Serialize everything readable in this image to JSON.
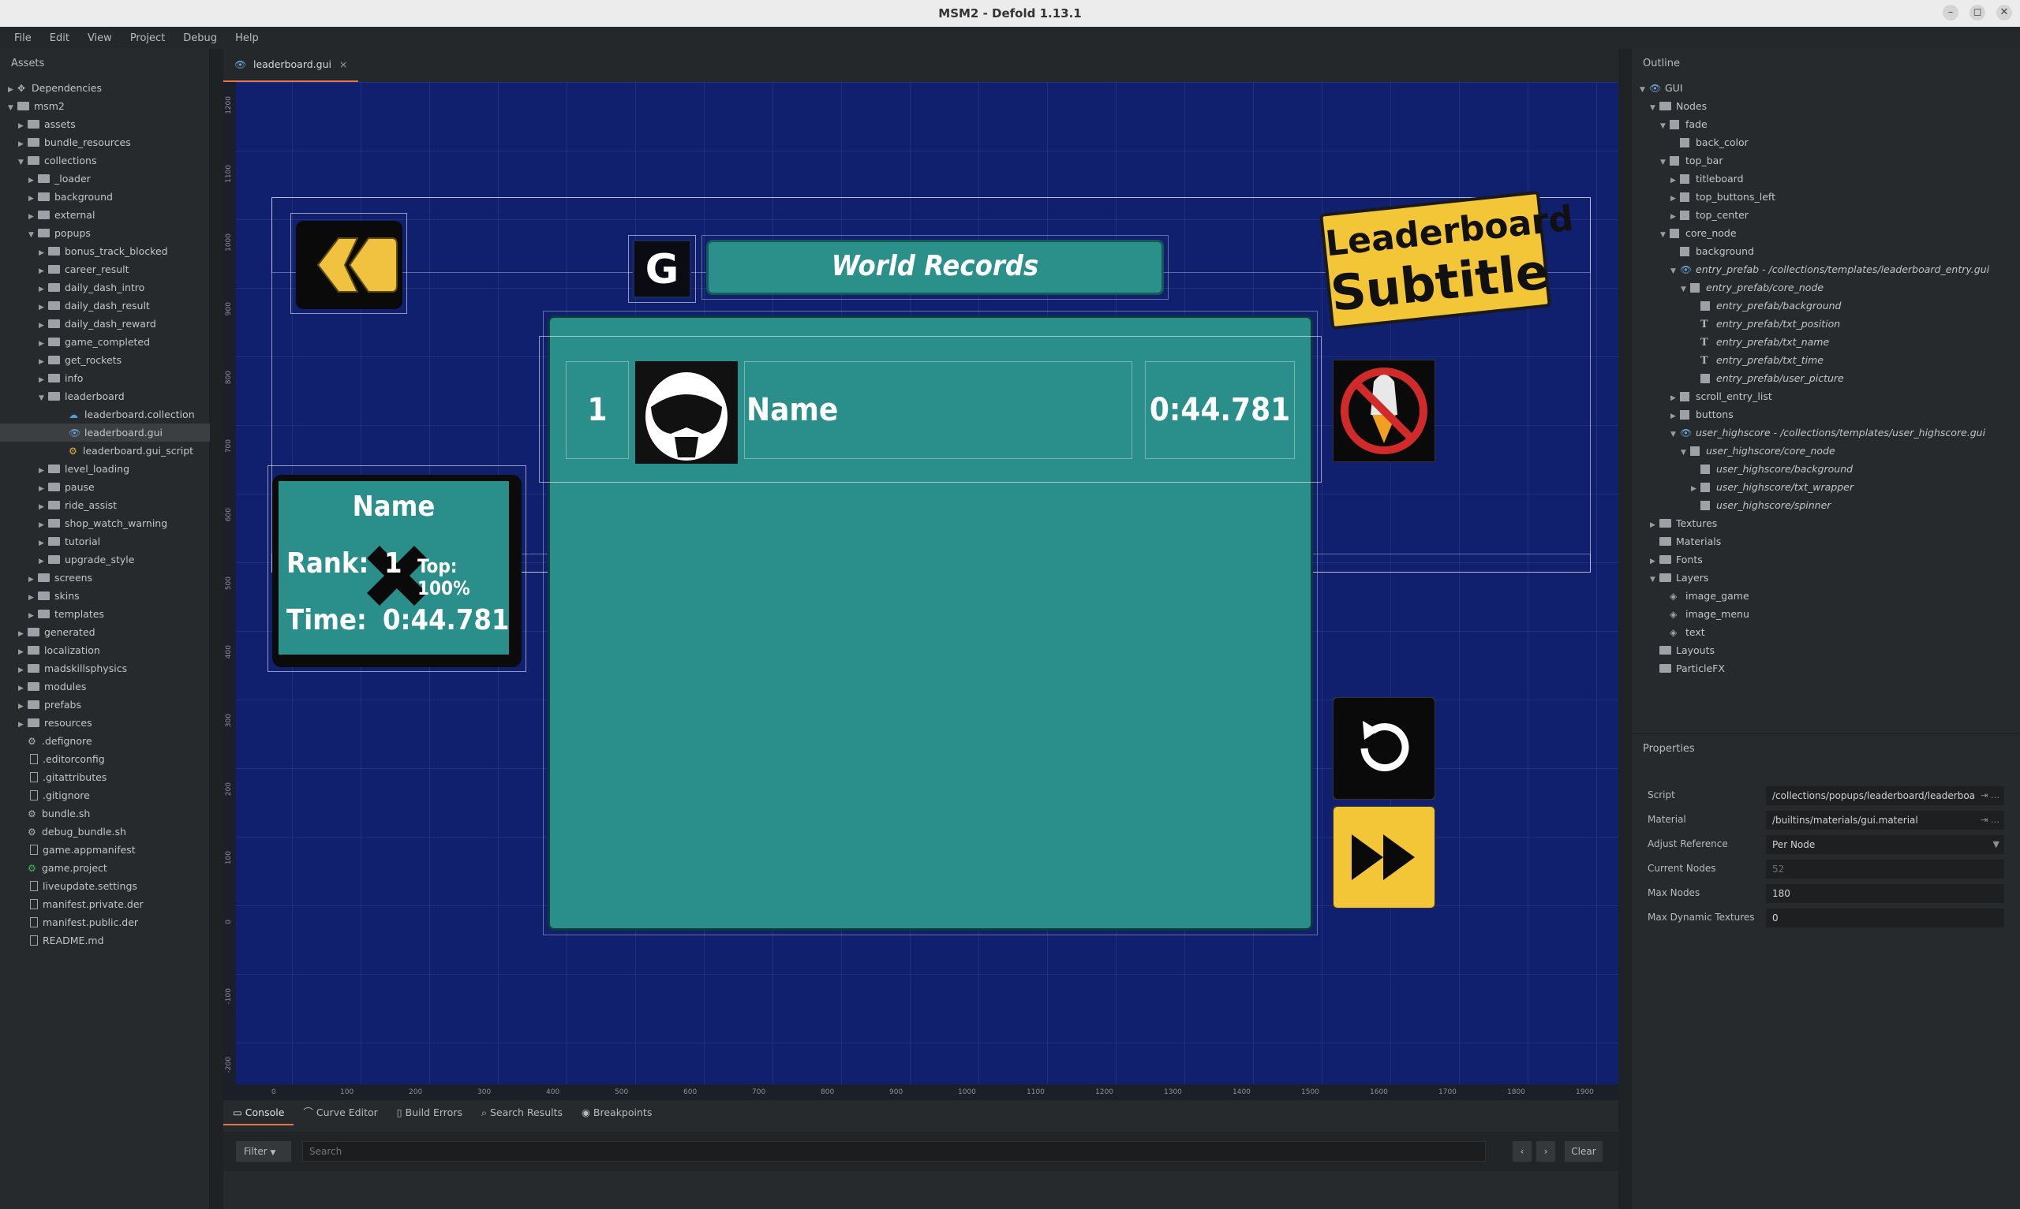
{
  "window": {
    "title": "MSM2 - Defold 1.13.1",
    "min": "–",
    "max": "◻",
    "close": "✕"
  },
  "menu": [
    "File",
    "Edit",
    "View",
    "Project",
    "Debug",
    "Help"
  ],
  "assets": {
    "title": "Assets",
    "items": [
      {
        "label": "Dependencies",
        "depth": 0,
        "arrow": "▶",
        "icon": "puzzle"
      },
      {
        "label": "msm2",
        "depth": 0,
        "arrow": "▼",
        "icon": "folder"
      },
      {
        "label": "assets",
        "depth": 1,
        "arrow": "▶",
        "icon": "folder"
      },
      {
        "label": "bundle_resources",
        "depth": 1,
        "arrow": "▶",
        "icon": "folder"
      },
      {
        "label": "collections",
        "depth": 1,
        "arrow": "▼",
        "icon": "folder"
      },
      {
        "label": "_loader",
        "depth": 2,
        "arrow": "▶",
        "icon": "folder"
      },
      {
        "label": "background",
        "depth": 2,
        "arrow": "▶",
        "icon": "folder"
      },
      {
        "label": "external",
        "depth": 2,
        "arrow": "▶",
        "icon": "folder"
      },
      {
        "label": "popups",
        "depth": 2,
        "arrow": "▼",
        "icon": "folder"
      },
      {
        "label": "bonus_track_blocked",
        "depth": 3,
        "arrow": "▶",
        "icon": "folder"
      },
      {
        "label": "career_result",
        "depth": 3,
        "arrow": "▶",
        "icon": "folder"
      },
      {
        "label": "daily_dash_intro",
        "depth": 3,
        "arrow": "▶",
        "icon": "folder"
      },
      {
        "label": "daily_dash_result",
        "depth": 3,
        "arrow": "▶",
        "icon": "folder"
      },
      {
        "label": "daily_dash_reward",
        "depth": 3,
        "arrow": "▶",
        "icon": "folder"
      },
      {
        "label": "game_completed",
        "depth": 3,
        "arrow": "▶",
        "icon": "folder"
      },
      {
        "label": "get_rockets",
        "depth": 3,
        "arrow": "▶",
        "icon": "folder"
      },
      {
        "label": "info",
        "depth": 3,
        "arrow": "▶",
        "icon": "folder"
      },
      {
        "label": "leaderboard",
        "depth": 3,
        "arrow": "▼",
        "icon": "folder"
      },
      {
        "label": "leaderboard.collection",
        "depth": 5,
        "arrow": "",
        "icon": "collection"
      },
      {
        "label": "leaderboard.gui",
        "depth": 5,
        "arrow": "",
        "icon": "eye",
        "selected": true
      },
      {
        "label": "leaderboard.gui_script",
        "depth": 5,
        "arrow": "",
        "icon": "gear-yellow"
      },
      {
        "label": "level_loading",
        "depth": 3,
        "arrow": "▶",
        "icon": "folder"
      },
      {
        "label": "pause",
        "depth": 3,
        "arrow": "▶",
        "icon": "folder"
      },
      {
        "label": "ride_assist",
        "depth": 3,
        "arrow": "▶",
        "icon": "folder"
      },
      {
        "label": "shop_watch_warning",
        "depth": 3,
        "arrow": "▶",
        "icon": "folder"
      },
      {
        "label": "tutorial",
        "depth": 3,
        "arrow": "▶",
        "icon": "folder"
      },
      {
        "label": "upgrade_style",
        "depth": 3,
        "arrow": "▶",
        "icon": "folder"
      },
      {
        "label": "screens",
        "depth": 2,
        "arrow": "▶",
        "icon": "folder"
      },
      {
        "label": "skins",
        "depth": 2,
        "arrow": "▶",
        "icon": "folder"
      },
      {
        "label": "templates",
        "depth": 2,
        "arrow": "▶",
        "icon": "folder"
      },
      {
        "label": "generated",
        "depth": 1,
        "arrow": "▶",
        "icon": "folder"
      },
      {
        "label": "localization",
        "depth": 1,
        "arrow": "▶",
        "icon": "folder"
      },
      {
        "label": "madskillsphysics",
        "depth": 1,
        "arrow": "▶",
        "icon": "folder"
      },
      {
        "label": "modules",
        "depth": 1,
        "arrow": "▶",
        "icon": "folder"
      },
      {
        "label": "prefabs",
        "depth": 1,
        "arrow": "▶",
        "icon": "folder"
      },
      {
        "label": "resources",
        "depth": 1,
        "arrow": "▶",
        "icon": "folder"
      },
      {
        "label": ".defignore",
        "depth": 1,
        "arrow": "",
        "icon": "gear"
      },
      {
        "label": ".editorconfig",
        "depth": 1,
        "arrow": "",
        "icon": "file"
      },
      {
        "label": ".gitattributes",
        "depth": 1,
        "arrow": "",
        "icon": "file"
      },
      {
        "label": ".gitignore",
        "depth": 1,
        "arrow": "",
        "icon": "file"
      },
      {
        "label": "bundle.sh",
        "depth": 1,
        "arrow": "",
        "icon": "gear"
      },
      {
        "label": "debug_bundle.sh",
        "depth": 1,
        "arrow": "",
        "icon": "gear"
      },
      {
        "label": "game.appmanifest",
        "depth": 1,
        "arrow": "",
        "icon": "file"
      },
      {
        "label": "game.project",
        "depth": 1,
        "arrow": "",
        "icon": "gear-green"
      },
      {
        "label": "liveupdate.settings",
        "depth": 1,
        "arrow": "",
        "icon": "file"
      },
      {
        "label": "manifest.private.der",
        "depth": 1,
        "arrow": "",
        "icon": "file"
      },
      {
        "label": "manifest.public.der",
        "depth": 1,
        "arrow": "",
        "icon": "file"
      },
      {
        "label": "README.md",
        "depth": 1,
        "arrow": "",
        "icon": "file"
      }
    ]
  },
  "editor_tab": {
    "label": "leaderboard.gui",
    "close": "×"
  },
  "gui": {
    "world_records": "World Records",
    "subtitle_line1": "Leaderboard",
    "subtitle_line2": "Subtitle",
    "entry_position": "1",
    "entry_name": "Name",
    "entry_time": "0:44.781",
    "user_name": "Name",
    "user_rank_label": "Rank:",
    "user_rank_value": "1",
    "user_top": "Top: 100%",
    "user_time_label": "Time:",
    "user_time_value": "0:44.781",
    "refresh_letter": "G"
  },
  "ruler": {
    "x": [
      "0",
      "100",
      "200",
      "300",
      "400",
      "500",
      "600",
      "700",
      "800",
      "900",
      "1000",
      "1100",
      "1200",
      "1300",
      "1400",
      "1500",
      "1600",
      "1700",
      "1800",
      "1900"
    ],
    "y": [
      "1200",
      "1100",
      "1000",
      "900",
      "800",
      "700",
      "600",
      "500",
      "400",
      "300",
      "200",
      "100",
      "0",
      "-100",
      "-200"
    ]
  },
  "bottom_tabs": [
    "Console",
    "Curve Editor",
    "Build Errors",
    "Search Results",
    "Breakpoints"
  ],
  "console": {
    "filter": "Filter",
    "search_placeholder": "Search",
    "prev": "‹",
    "next": "›",
    "clear": "Clear"
  },
  "outline": {
    "title": "Outline",
    "items": [
      {
        "label": "GUI",
        "depth": 0,
        "arrow": "▼",
        "icon": "eye"
      },
      {
        "label": "Nodes",
        "depth": 1,
        "arrow": "▼",
        "icon": "folder"
      },
      {
        "label": "fade",
        "depth": 2,
        "arrow": "▼",
        "icon": "node"
      },
      {
        "label": "back_color",
        "depth": 3,
        "arrow": "",
        "icon": "node"
      },
      {
        "label": "top_bar",
        "depth": 2,
        "arrow": "▼",
        "icon": "node"
      },
      {
        "label": "titleboard",
        "depth": 3,
        "arrow": "▶",
        "icon": "node"
      },
      {
        "label": "top_buttons_left",
        "depth": 3,
        "arrow": "▶",
        "icon": "node"
      },
      {
        "label": "top_center",
        "depth": 3,
        "arrow": "▶",
        "icon": "node"
      },
      {
        "label": "core_node",
        "depth": 2,
        "arrow": "▼",
        "icon": "node"
      },
      {
        "label": "background",
        "depth": 3,
        "arrow": "",
        "icon": "node"
      },
      {
        "label": "entry_prefab - /collections/templates/leaderboard_entry.gui",
        "depth": 3,
        "arrow": "▼",
        "icon": "eye",
        "italic": true
      },
      {
        "label": "entry_prefab/core_node",
        "depth": 4,
        "arrow": "▼",
        "icon": "node",
        "italic": true
      },
      {
        "label": "entry_prefab/background",
        "depth": 5,
        "arrow": "",
        "icon": "node",
        "italic": true
      },
      {
        "label": "entry_prefab/txt_position",
        "depth": 5,
        "arrow": "",
        "icon": "text",
        "italic": true
      },
      {
        "label": "entry_prefab/txt_name",
        "depth": 5,
        "arrow": "",
        "icon": "text",
        "italic": true
      },
      {
        "label": "entry_prefab/txt_time",
        "depth": 5,
        "arrow": "",
        "icon": "text",
        "italic": true
      },
      {
        "label": "entry_prefab/user_picture",
        "depth": 5,
        "arrow": "",
        "icon": "node",
        "italic": true
      },
      {
        "label": "scroll_entry_list",
        "depth": 3,
        "arrow": "▶",
        "icon": "node"
      },
      {
        "label": "buttons",
        "depth": 3,
        "arrow": "▶",
        "icon": "node"
      },
      {
        "label": "user_highscore - /collections/templates/user_highscore.gui",
        "depth": 3,
        "arrow": "▼",
        "icon": "eye",
        "italic": true
      },
      {
        "label": "user_highscore/core_node",
        "depth": 4,
        "arrow": "▼",
        "icon": "node",
        "italic": true
      },
      {
        "label": "user_highscore/background",
        "depth": 5,
        "arrow": "",
        "icon": "node",
        "italic": true
      },
      {
        "label": "user_highscore/txt_wrapper",
        "depth": 5,
        "arrow": "▶",
        "icon": "node",
        "italic": true
      },
      {
        "label": "user_highscore/spinner",
        "depth": 5,
        "arrow": "",
        "icon": "node",
        "italic": true
      },
      {
        "label": "Textures",
        "depth": 1,
        "arrow": "▶",
        "icon": "folder"
      },
      {
        "label": "Materials",
        "depth": 1,
        "arrow": "",
        "icon": "folder"
      },
      {
        "label": "Fonts",
        "depth": 1,
        "arrow": "▶",
        "icon": "folder"
      },
      {
        "label": "Layers",
        "depth": 1,
        "arrow": "▼",
        "icon": "folder"
      },
      {
        "label": "image_game",
        "depth": 2,
        "arrow": "",
        "icon": "layer"
      },
      {
        "label": "image_menu",
        "depth": 2,
        "arrow": "",
        "icon": "layer"
      },
      {
        "label": "text",
        "depth": 2,
        "arrow": "",
        "icon": "layer"
      },
      {
        "label": "Layouts",
        "depth": 1,
        "arrow": "",
        "icon": "folder"
      },
      {
        "label": "ParticleFX",
        "depth": 1,
        "arrow": "",
        "icon": "folder"
      }
    ]
  },
  "properties": {
    "title": "Properties",
    "rows": [
      {
        "label": "Script",
        "value": "/collections/popups/leaderboard/leaderboa",
        "icons": "⇥  …"
      },
      {
        "label": "Material",
        "value": "/builtins/materials/gui.material",
        "icons": "⇥  …"
      },
      {
        "label": "Adjust Reference",
        "value": "Per Node",
        "icons": "▼"
      },
      {
        "label": "Current Nodes",
        "value": "52",
        "dim": true,
        "icons": ""
      },
      {
        "label": "Max Nodes",
        "value": "180",
        "icons": ""
      },
      {
        "label": "Max Dynamic Textures",
        "value": "0",
        "icons": ""
      }
    ]
  }
}
